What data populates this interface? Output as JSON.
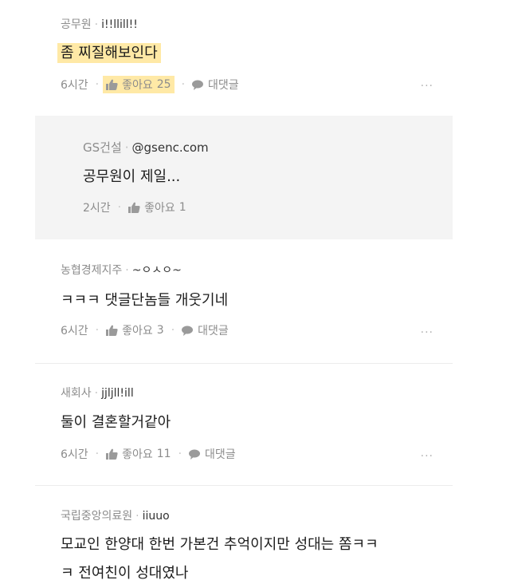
{
  "comments": [
    {
      "author": "공무원",
      "handle": "i!!llill!!",
      "text": "좀 찌질해보인다",
      "time": "6시간",
      "like_label": "좋아요",
      "like_count": "25",
      "reply_label": "대댓글",
      "more": "..."
    },
    {
      "author": "GS건설",
      "handle": "@gsenc.com",
      "text": "공무원이 제일...",
      "time": "2시간",
      "like_label": "좋아요",
      "like_count": "1"
    },
    {
      "author": "농협경제지주",
      "handle": "~ㅇㅅㅇ~",
      "text": "ㅋㅋㅋ 댓글단놈들 개웃기네",
      "time": "6시간",
      "like_label": "좋아요",
      "like_count": "3",
      "reply_label": "대댓글",
      "more": "..."
    },
    {
      "author": "새회사",
      "handle": "jjljll!ill",
      "text": "둘이 결혼할거같아",
      "time": "6시간",
      "like_label": "좋아요",
      "like_count": "11",
      "reply_label": "대댓글",
      "more": "..."
    },
    {
      "author": "국립중앙의료원",
      "handle": "iiuuo",
      "text_line1": "모교인 한양대 한번 가본건 추억이지만 성대는 쫌ㅋㅋ",
      "text_line2": "ㅋ 전여친이 성대였나"
    }
  ],
  "separator": "·",
  "colors": {
    "highlight": "#ffe9a6",
    "reply_background": "#f4f4f4",
    "meta_text": "#8c8c8c"
  },
  "icons": [
    "thumbs-up-icon",
    "speech-bubble-icon",
    "more-dots-icon"
  ]
}
